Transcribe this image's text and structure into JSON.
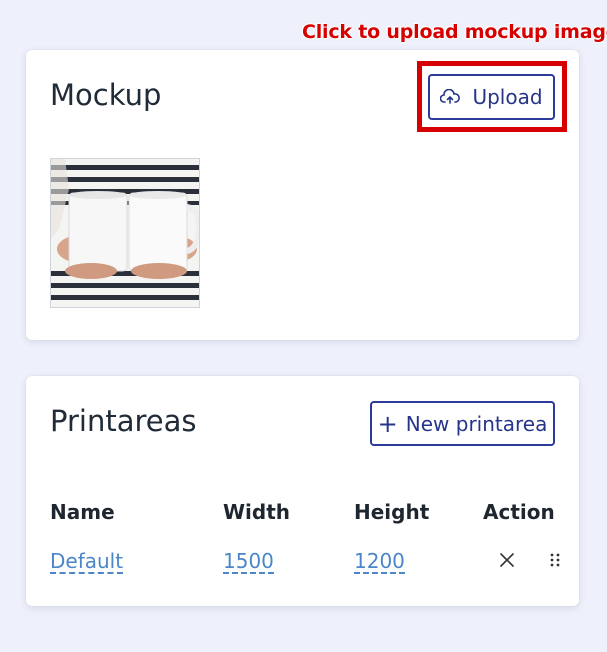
{
  "annotation": {
    "text": "Click to upload mockup image",
    "color": "#d60000"
  },
  "mockup": {
    "title": "Mockup",
    "upload_label": "Upload",
    "upload_icon": "cloud-upload-icon",
    "thumbnail_description": "white-mugs-photo"
  },
  "printareas": {
    "title": "Printareas",
    "new_label": "New printarea",
    "new_icon": "plus-icon",
    "columns": [
      "Name",
      "Width",
      "Height",
      "Action"
    ],
    "rows": [
      {
        "name": "Default",
        "width": "1500",
        "height": "1200"
      }
    ],
    "actions": [
      "close-icon",
      "drag-handle-icon"
    ]
  },
  "colors": {
    "background": "#eef1fb",
    "accent": "#2c3a9c",
    "link": "#4a86c9",
    "highlight": "#d60000"
  }
}
